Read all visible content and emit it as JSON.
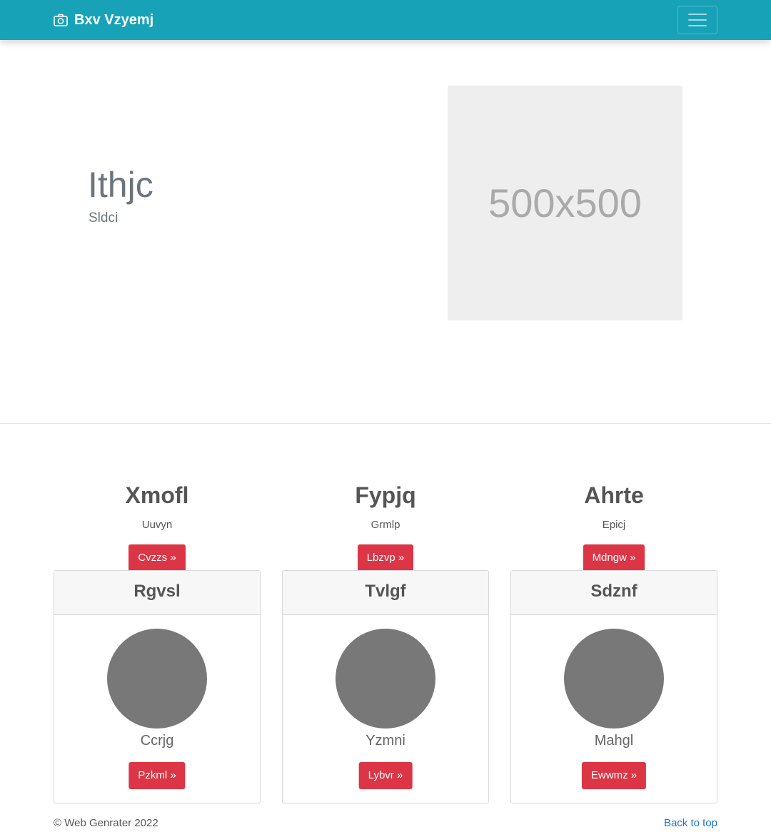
{
  "navbar": {
    "brand": "Bxv Vzyemj",
    "brand_icon": "camera-icon",
    "toggler_icon": "hamburger-menu-icon",
    "background": "#17a2b8"
  },
  "hero": {
    "title": "Ithjc",
    "subtitle": "Sldci",
    "image_placeholder": "500x500"
  },
  "features": [
    {
      "title": "Xmofl",
      "text": "Uuvyn",
      "button": "Cvzzs »"
    },
    {
      "title": "Fypjq",
      "text": "Grmlp",
      "button": "Lbzvp »"
    },
    {
      "title": "Ahrte",
      "text": "Epicj",
      "button": "Mdngw »"
    }
  ],
  "cards": [
    {
      "header": "Rgvsl",
      "name": "Ccrjg",
      "button": "Pzkml »"
    },
    {
      "header": "Tvlgf",
      "name": "Yzmni",
      "button": "Lybvr »"
    },
    {
      "header": "Sdznf",
      "name": "Mahgl",
      "button": "Ewwmz »"
    }
  ],
  "footer": {
    "copyright": "© Web Genrater 2022",
    "back_to_top": "Back to top"
  },
  "colors": {
    "accent": "#17a2b8",
    "button": "#dc3545",
    "avatar": "#787878",
    "link": "#1a73c9"
  }
}
